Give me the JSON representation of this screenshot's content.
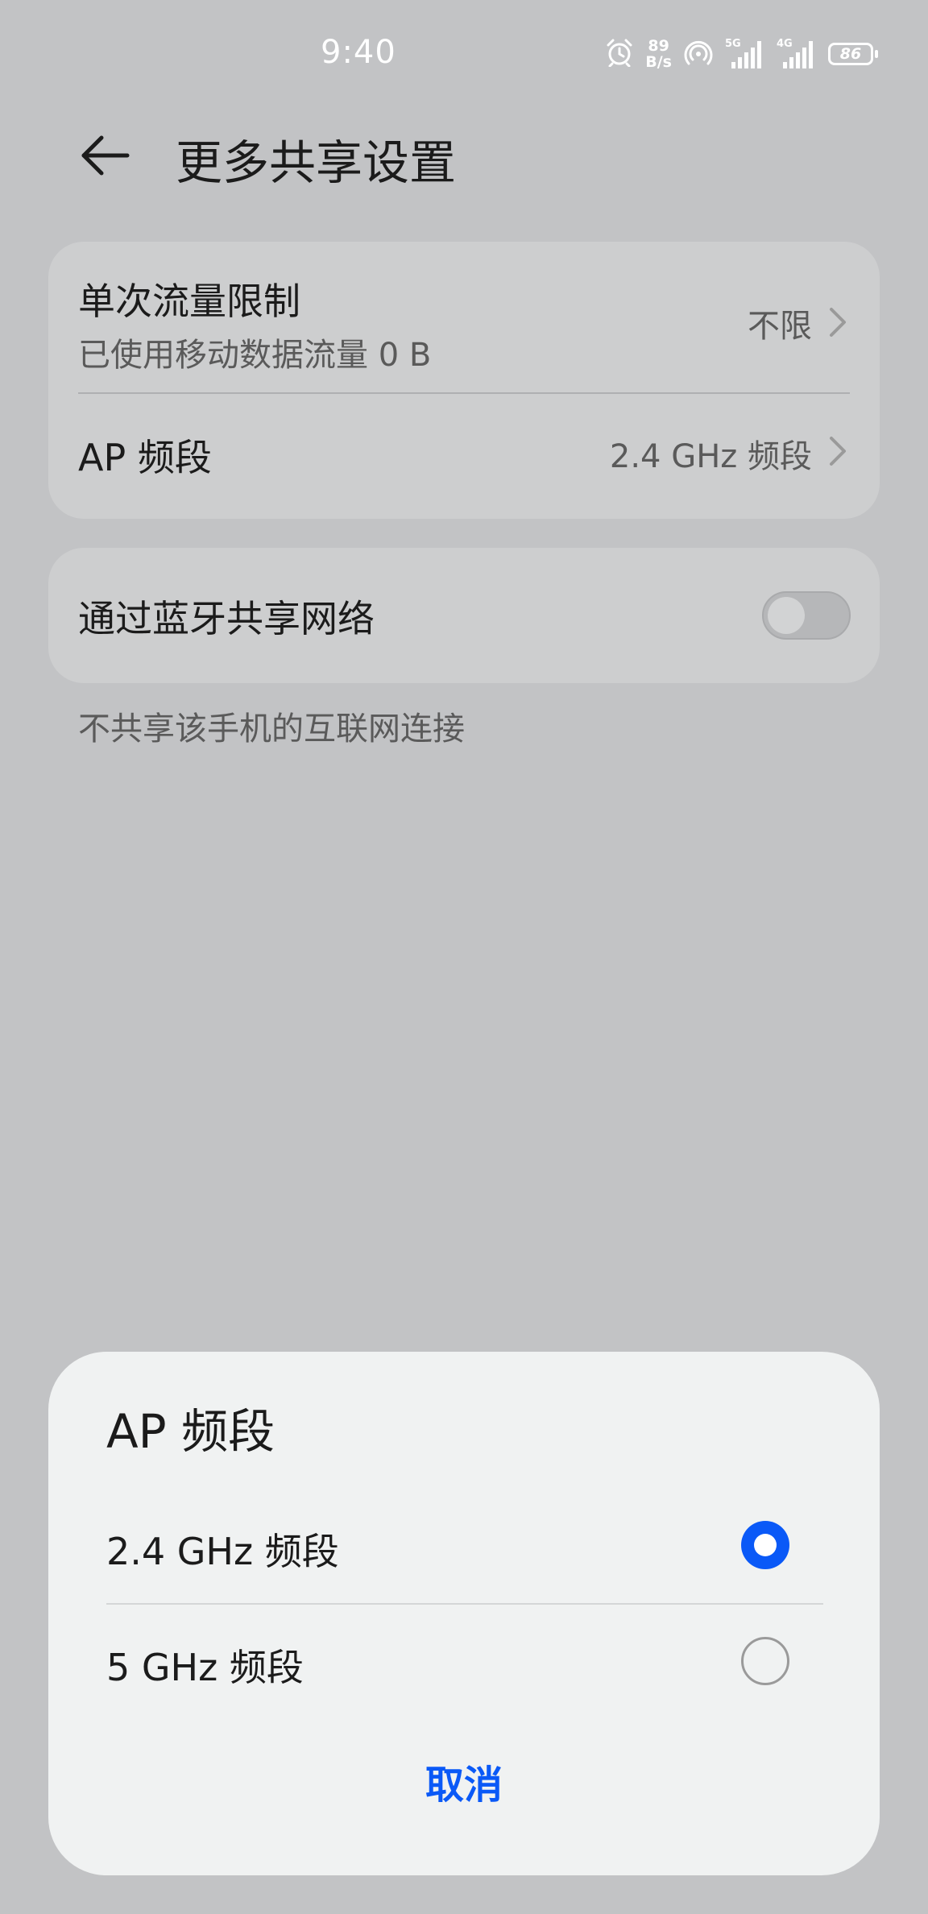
{
  "status_bar": {
    "time": "9:40",
    "net_speed_value": "89",
    "net_speed_unit": "B/s",
    "signal_1_tag": "5G",
    "signal_2_tag": "4G",
    "battery": "86",
    "icons": [
      "alarm-icon",
      "hotspot-icon",
      "signal-5g-icon",
      "signal-4g-icon",
      "battery-icon"
    ]
  },
  "header": {
    "title": "更多共享设置",
    "back_icon": "arrow-left-icon"
  },
  "settings": {
    "data_limit": {
      "title": "单次流量限制",
      "subtitle": "已使用移动数据流量 0 B",
      "value": "不限"
    },
    "ap_band": {
      "title": "AP 频段",
      "value": "2.4 GHz 频段"
    },
    "bluetooth_tethering": {
      "title": "通过蓝牙共享网络",
      "enabled": false,
      "caption": "不共享该手机的互联网连接"
    }
  },
  "dialog": {
    "title": "AP 频段",
    "options": [
      {
        "label": "2.4 GHz 频段",
        "selected": true
      },
      {
        "label": "5 GHz 频段",
        "selected": false
      }
    ],
    "cancel_label": "取消"
  },
  "colors": {
    "accent": "#0a59f7",
    "background": "#c2c3c5",
    "card": "#cdcecf",
    "dialog": "#f0f2f2"
  }
}
